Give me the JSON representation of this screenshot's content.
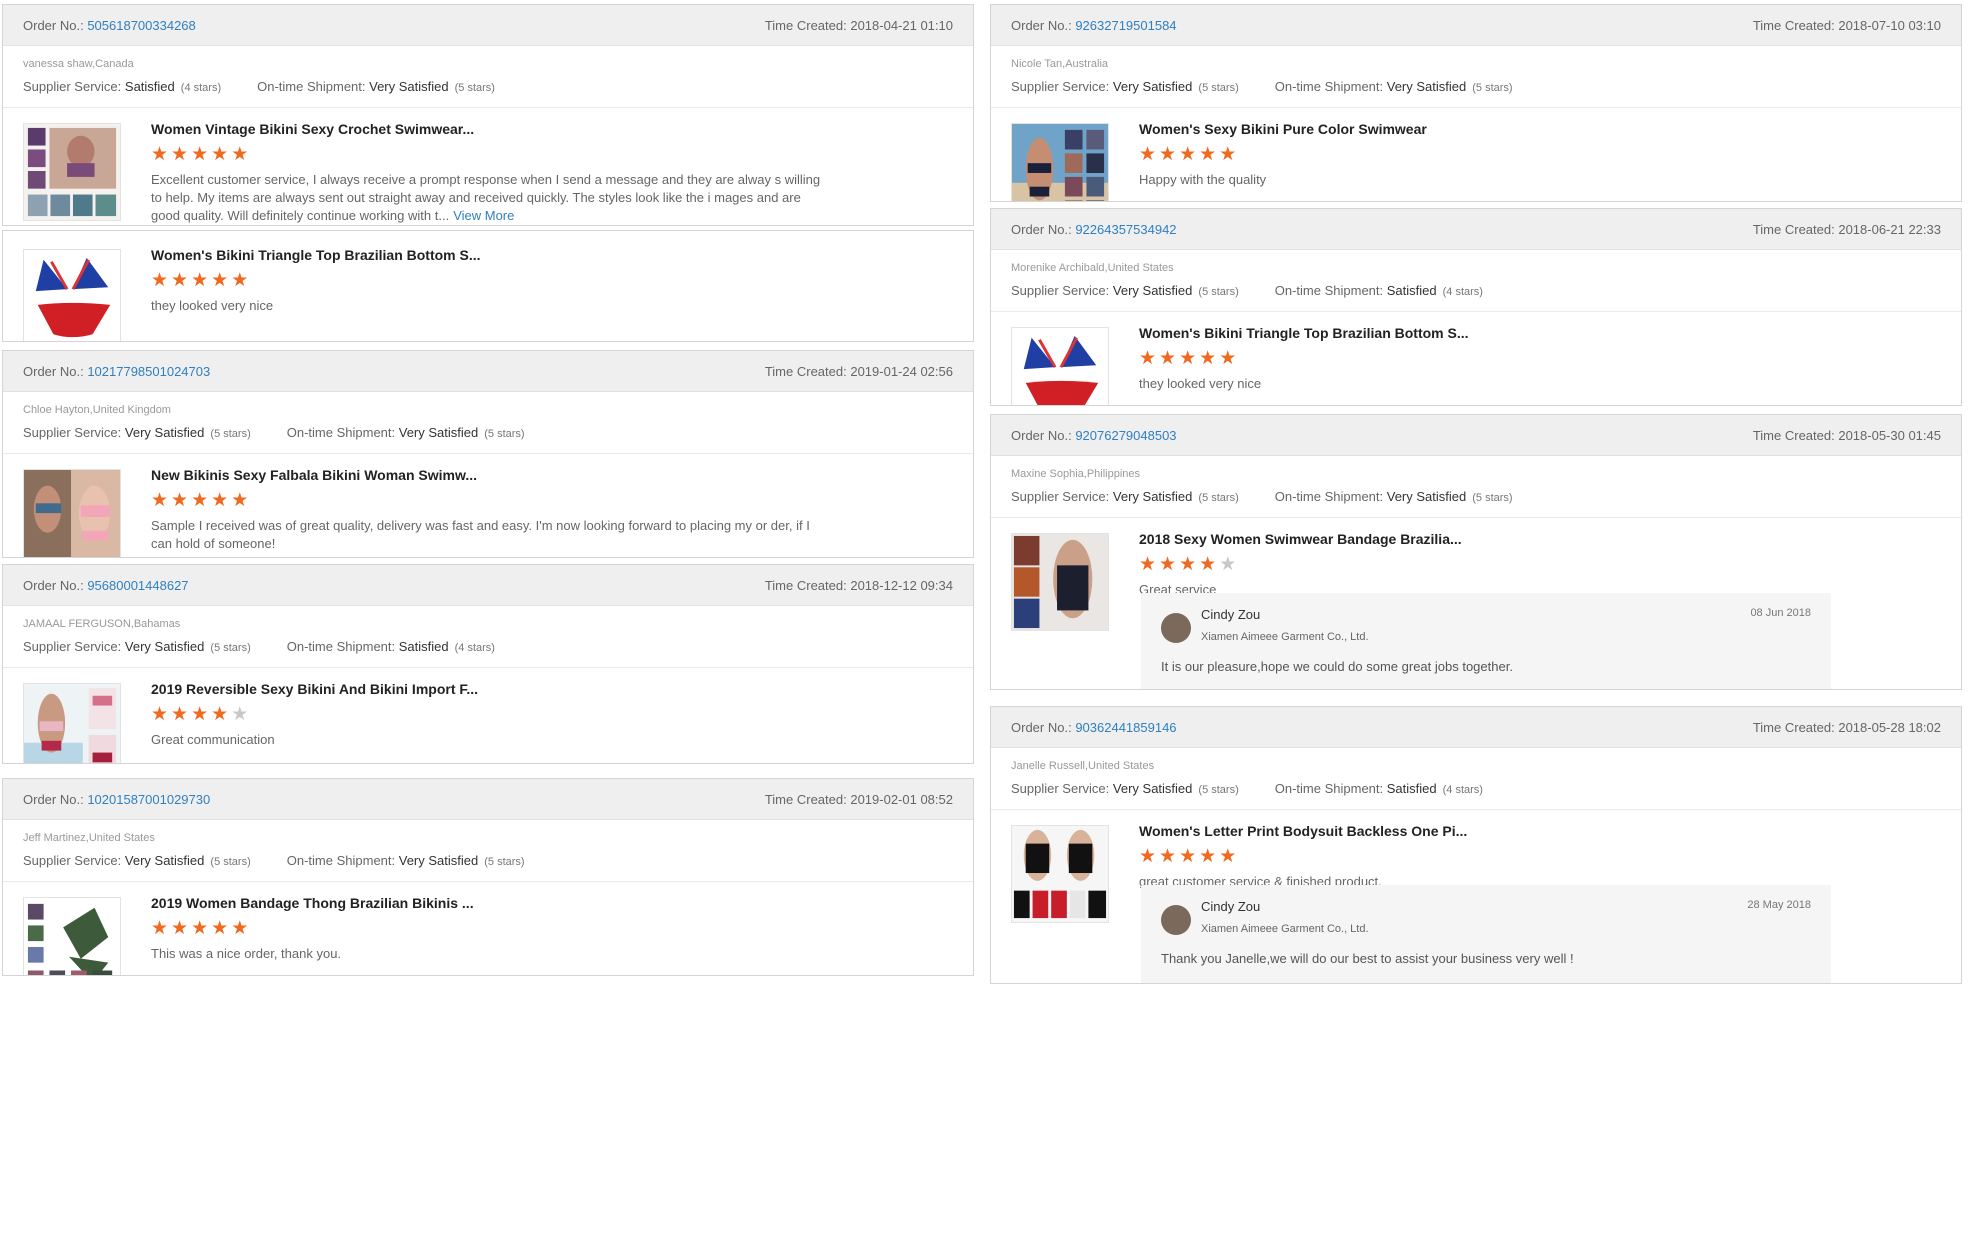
{
  "labels": {
    "order_no": "Order No.:",
    "time_created": "Time Created:",
    "supplier_service": "Supplier Service:",
    "on_time_shipment": "On-time Shipment:",
    "view_more": "View More"
  },
  "colors": {
    "accent_link": "#2f7fc1",
    "star": "#ef6a1f",
    "star_off": "#c8c8c8"
  },
  "left": [
    {
      "order_no": "505618700334268",
      "time": "2018-04-21 01:10",
      "buyer": "vanessa shaw,Canada",
      "supplier": "Satisfied",
      "supplier_stars": "(4 stars)",
      "shipment": "Very Satisfied",
      "shipment_stars": "(5 stars)",
      "items": [
        {
          "title": "Women Vintage Bikini Sexy Crochet Swimwear...",
          "stars": 5,
          "comment": "Excellent customer service, I always receive a prompt response when I send a message and they are alway s willing to help. My items are always sent out straight away and received quickly. The styles look like the i mages and are good quality. Will definitely continue working with t...",
          "icon": "swimwear-grid-thumbnail"
        },
        {
          "title": "Women's Bikini Triangle Top Brazilian Bottom S...",
          "stars": 5,
          "comment": "they looked very nice",
          "icon": "red-bikini-thumbnail"
        }
      ]
    },
    {
      "order_no": "10217798501024703",
      "time": "2019-01-24 02:56",
      "buyer": "Chloe Hayton,United Kingdom",
      "supplier": "Very Satisfied",
      "supplier_stars": "(5 stars)",
      "shipment": "Very Satisfied",
      "shipment_stars": "(5 stars)",
      "items": [
        {
          "title": "New Bikinis Sexy Falbala Bikini Woman Swimw...",
          "stars": 5,
          "comment": "Sample I received was of great quality, delivery was fast and easy. I'm now looking forward to placing my or der, if I can hold of someone!",
          "icon": "falbala-bikini-thumbnail"
        }
      ]
    },
    {
      "order_no": "95680001448627",
      "time": "2018-12-12 09:34",
      "buyer": "JAMAAL FERGUSON,Bahamas",
      "supplier": "Very Satisfied",
      "supplier_stars": "(5 stars)",
      "shipment": "Satisfied",
      "shipment_stars": "(4 stars)",
      "items": [
        {
          "title": "2019 Reversible Sexy Bikini And Bikini Import F...",
          "stars": 4,
          "comment": "Great communication",
          "icon": "reversible-bikini-thumbnail"
        }
      ]
    },
    {
      "order_no": "10201587001029730",
      "time": "2019-02-01 08:52",
      "buyer": "Jeff Martinez,United States",
      "supplier": "Very Satisfied",
      "supplier_stars": "(5 stars)",
      "shipment": "Very Satisfied",
      "shipment_stars": "(5 stars)",
      "items": [
        {
          "title": "2019 Women Bandage Thong Brazilian Bikinis ...",
          "stars": 5,
          "comment": "This was a nice order, thank you.",
          "icon": "bandage-bikini-thumbnail"
        }
      ]
    }
  ],
  "right": [
    {
      "order_no": "92632719501584",
      "time": "2018-07-10 03:10",
      "buyer": "Nicole Tan,Australia",
      "supplier": "Very Satisfied",
      "supplier_stars": "(5 stars)",
      "shipment": "Very Satisfied",
      "shipment_stars": "(5 stars)",
      "items": [
        {
          "title": "Women's Sexy Bikini Pure Color Swimwear",
          "stars": 5,
          "comment": "Happy with the quality",
          "icon": "beach-bikini-thumbnail"
        }
      ]
    },
    {
      "order_no": "92264357534942",
      "time": "2018-06-21 22:33",
      "buyer": "Morenike Archibald,United States",
      "supplier": "Very Satisfied",
      "supplier_stars": "(5 stars)",
      "shipment": "Satisfied",
      "shipment_stars": "(4 stars)",
      "items": [
        {
          "title": "Women's Bikini Triangle Top Brazilian Bottom S...",
          "stars": 5,
          "comment": "they looked very nice",
          "icon": "red-bikini-thumbnail"
        }
      ]
    },
    {
      "order_no": "92076279048503",
      "time": "2018-05-30 01:45",
      "buyer": "Maxine Sophia,Philippines",
      "supplier": "Very Satisfied",
      "supplier_stars": "(5 stars)",
      "shipment": "Very Satisfied",
      "shipment_stars": "(5 stars)",
      "items": [
        {
          "title": "2018 Sexy Women Swimwear Bandage Brazilia...",
          "stars": 4,
          "comment": "Great service",
          "icon": "bandage-swimwear-thumbnail"
        }
      ],
      "reply": {
        "name": "Cindy Zou",
        "company": "Xiamen Aimeee Garment Co., Ltd.",
        "date": "08 Jun 2018",
        "text": "It is our pleasure,hope we could do some great jobs together."
      }
    },
    {
      "order_no": "90362441859146",
      "time": "2018-05-28 18:02",
      "buyer": "Janelle Russell,United States",
      "supplier": "Very Satisfied",
      "supplier_stars": "(5 stars)",
      "shipment": "Satisfied",
      "shipment_stars": "(4 stars)",
      "items": [
        {
          "title": "Women's Letter Print Bodysuit Backless One Pi...",
          "stars": 5,
          "comment": "great customer service & finished product.",
          "icon": "bodysuit-thumbnail"
        }
      ],
      "reply": {
        "name": "Cindy Zou",
        "company": "Xiamen Aimeee Garment Co., Ltd.",
        "date": "28 May 2018",
        "text": "Thank you Janelle,we will do our best to assist your business very well !"
      }
    }
  ]
}
